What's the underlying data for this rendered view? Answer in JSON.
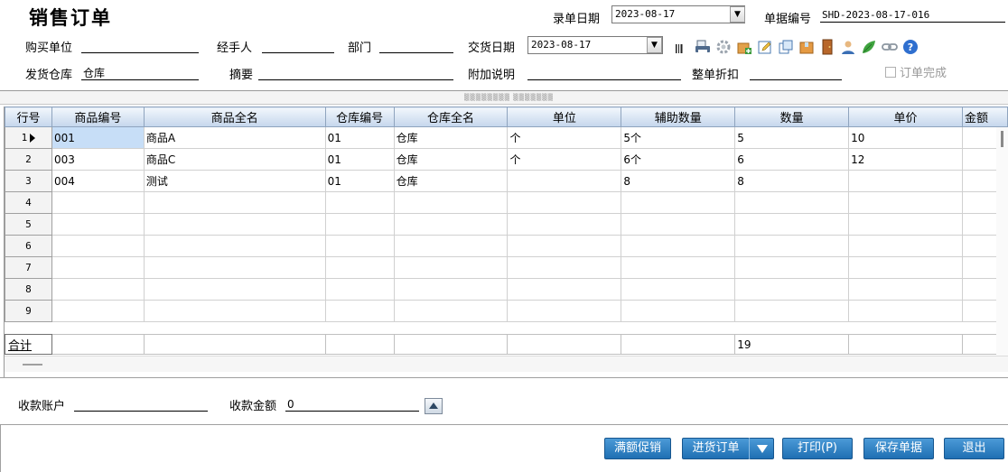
{
  "header": {
    "title": "销售订单",
    "entry_date_label": "录单日期",
    "entry_date_value": "2023-08-17",
    "doc_no_label": "单据编号",
    "doc_no_value": "SHD-2023-08-17-016"
  },
  "form": {
    "buyer_label": "购买单位",
    "buyer_value": "",
    "handler_label": "经手人",
    "handler_value": "",
    "dept_label": "部门",
    "dept_value": "",
    "delivery_date_label": "交货日期",
    "delivery_date_value": "2023-08-17",
    "warehouse_label": "发货仓库",
    "warehouse_value": "仓库",
    "summary_label": "摘要",
    "summary_value": "",
    "note_label": "附加说明",
    "note_value": "",
    "discount_label": "整单折扣",
    "discount_value": "",
    "order_complete_label": "订单完成"
  },
  "toolbar": {
    "icons": [
      "barcode-icon",
      "print-preview-icon",
      "settings-gear-icon",
      "import-icon",
      "edit-icon",
      "copy-icon",
      "box-icon",
      "door-icon",
      "user-icon",
      "leaf-icon",
      "link-icon",
      "help-icon"
    ]
  },
  "grid": {
    "columns": [
      "行号",
      "商品编号",
      "商品全名",
      "仓库编号",
      "仓库全名",
      "单位",
      "辅助数量",
      "数量",
      "单价",
      "金额"
    ],
    "rows": [
      {
        "no": "1",
        "code": "001",
        "name": "商品A",
        "wh_code": "01",
        "wh_name": "仓库",
        "unit": "个",
        "aux_qty": "5个",
        "qty": "5",
        "price": "10",
        "amount": ""
      },
      {
        "no": "2",
        "code": "003",
        "name": "商品C",
        "wh_code": "01",
        "wh_name": "仓库",
        "unit": "个",
        "aux_qty": "6个",
        "qty": "6",
        "price": "12",
        "amount": ""
      },
      {
        "no": "3",
        "code": "004",
        "name": "测试",
        "wh_code": "01",
        "wh_name": "仓库",
        "unit": "",
        "aux_qty": "8",
        "qty": "8",
        "price": "",
        "amount": ""
      },
      {
        "no": "4",
        "code": "",
        "name": "",
        "wh_code": "",
        "wh_name": "",
        "unit": "",
        "aux_qty": "",
        "qty": "",
        "price": "",
        "amount": ""
      },
      {
        "no": "5",
        "code": "",
        "name": "",
        "wh_code": "",
        "wh_name": "",
        "unit": "",
        "aux_qty": "",
        "qty": "",
        "price": "",
        "amount": ""
      },
      {
        "no": "6",
        "code": "",
        "name": "",
        "wh_code": "",
        "wh_name": "",
        "unit": "",
        "aux_qty": "",
        "qty": "",
        "price": "",
        "amount": ""
      },
      {
        "no": "7",
        "code": "",
        "name": "",
        "wh_code": "",
        "wh_name": "",
        "unit": "",
        "aux_qty": "",
        "qty": "",
        "price": "",
        "amount": ""
      },
      {
        "no": "8",
        "code": "",
        "name": "",
        "wh_code": "",
        "wh_name": "",
        "unit": "",
        "aux_qty": "",
        "qty": "",
        "price": "",
        "amount": ""
      },
      {
        "no": "9",
        "code": "",
        "name": "",
        "wh_code": "",
        "wh_name": "",
        "unit": "",
        "aux_qty": "",
        "qty": "",
        "price": "",
        "amount": ""
      }
    ],
    "total_label": "合计",
    "total_qty": "19"
  },
  "footer": {
    "account_label": "收款账户",
    "account_value": "",
    "amount_label": "收款金额",
    "amount_value": "0"
  },
  "buttons": {
    "promo": "满额促销",
    "purchase_order": "进货订单",
    "print": "打印(P)",
    "save": "保存单据",
    "exit": "退出"
  },
  "colors": {
    "button_blue": "#2a7fc2",
    "header_blue": "#c5d6ec",
    "selected_cell": "#c7def7"
  }
}
